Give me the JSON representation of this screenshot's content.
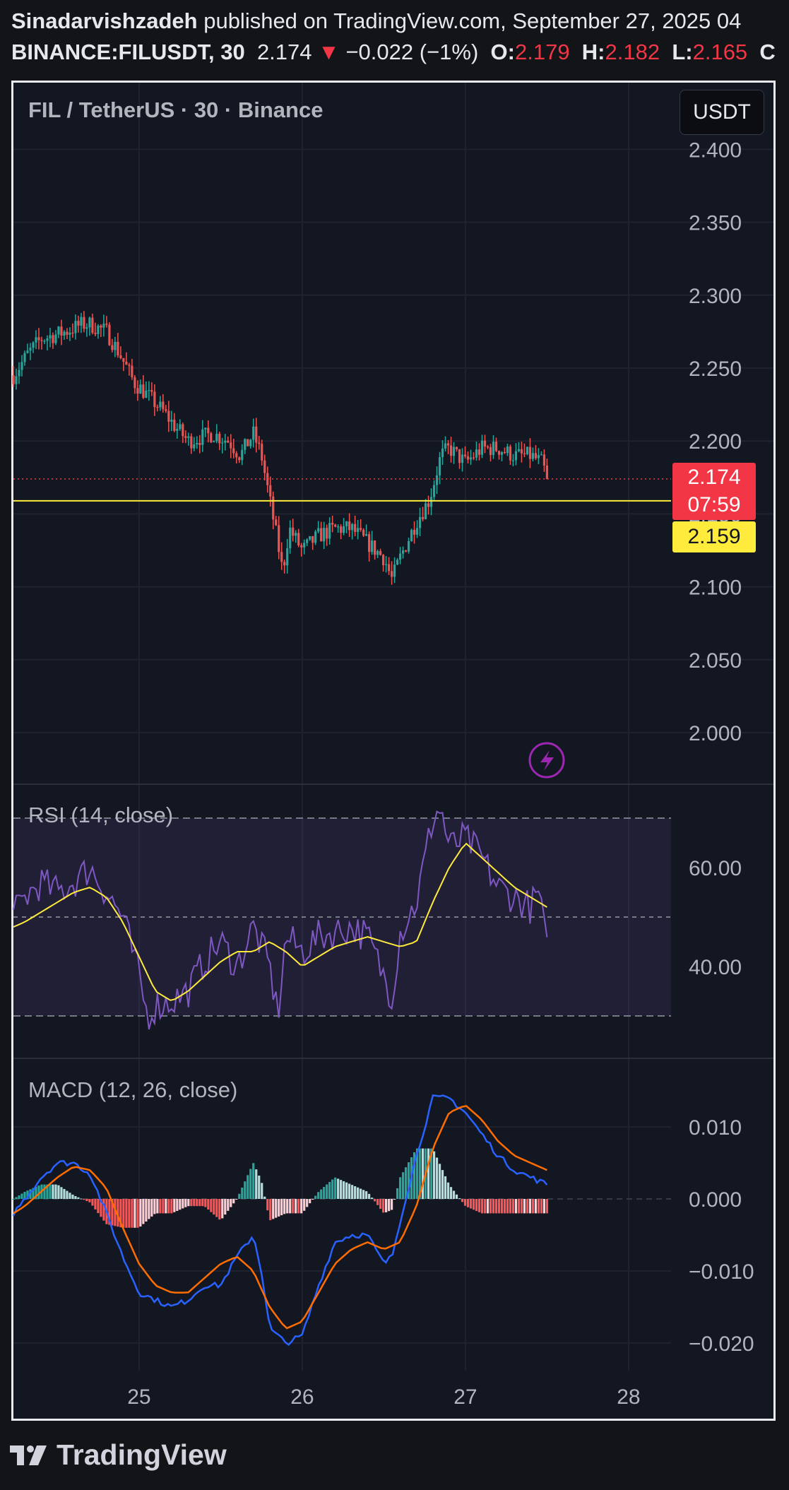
{
  "header": {
    "author": "Sinadarvishzadeh",
    "published_text": " published on TradingView.com, September 27, 2025 04",
    "symbol": "BINANCE:FILUSDT, 30",
    "last": "2.174",
    "change_arrow": "▼",
    "change": "−0.022 (−1%)",
    "o_label": "O:",
    "o_value": "2.179",
    "h_label": "H:",
    "h_value": "2.182",
    "l_label": "L:",
    "l_value": "2.165",
    "c_label": "C"
  },
  "chart_title": "FIL / TetherUS · 30 · Binance",
  "unit_button": "USDT",
  "current_price": "2.174",
  "countdown": "07:59",
  "level_price": "2.159",
  "rsi_label": "RSI (14, close)",
  "macd_label": "MACD (12, 26, close)",
  "footer_logo_text": "TradingView",
  "colors": {
    "up": "#26a69a",
    "down": "#ef5350",
    "rsi": "#7e57c2",
    "rsi_ma": "#ffeb3b",
    "macd": "#2962ff",
    "signal": "#ff6d00",
    "level": "#ffeb3b",
    "price_tag": "#f23645"
  },
  "chart_data": [
    {
      "type": "candlestick",
      "title": "FIL / TetherUS · 30 · Binance",
      "y_ticks": [
        "2.400",
        "2.350",
        "2.300",
        "2.250",
        "2.200",
        "2.150",
        "2.100",
        "2.050",
        "2.000"
      ],
      "ylim": [
        1.97,
        2.405
      ],
      "x_ticks": [
        "25",
        "26",
        "27",
        "28"
      ],
      "x_tick_values": [
        25,
        26,
        27,
        28
      ],
      "xlim": [
        24.23,
        28.26
      ],
      "horizontal_level": 2.159,
      "last_price": 2.174,
      "closes": {
        "x": [
          24.23,
          24.32,
          24.4,
          24.55,
          24.65,
          24.7,
          24.8,
          24.88,
          24.97,
          25.02,
          25.15,
          25.22,
          25.3,
          25.45,
          25.55,
          25.62,
          25.7,
          25.75,
          25.8,
          25.85,
          25.88,
          25.92,
          26.0,
          26.1,
          26.2,
          26.3,
          26.4,
          26.5,
          26.55,
          26.6,
          26.7,
          26.78,
          26.85,
          26.9,
          27.0,
          27.1,
          27.2,
          27.3,
          27.4,
          27.47,
          27.5
        ],
        "y": [
          2.245,
          2.26,
          2.27,
          2.275,
          2.28,
          2.28,
          2.275,
          2.26,
          2.24,
          2.235,
          2.22,
          2.21,
          2.2,
          2.205,
          2.2,
          2.19,
          2.205,
          2.19,
          2.16,
          2.13,
          2.11,
          2.14,
          2.125,
          2.135,
          2.14,
          2.14,
          2.13,
          2.12,
          2.105,
          2.12,
          2.145,
          2.16,
          2.19,
          2.195,
          2.185,
          2.195,
          2.195,
          2.19,
          2.19,
          2.185,
          2.174
        ]
      },
      "series": [
        {
          "name": "FIL / TetherUS",
          "type": "candles"
        }
      ]
    },
    {
      "type": "line",
      "title": "RSI (14, close)",
      "y_ticks": [
        "60.00",
        "40.00"
      ],
      "ylim": [
        24,
        76
      ],
      "bands": [
        30,
        50,
        70
      ],
      "series": [
        {
          "name": "RSI",
          "x": [
            24.23,
            24.3,
            24.4,
            24.5,
            24.6,
            24.7,
            24.8,
            24.9,
            25.0,
            25.05,
            25.1,
            25.2,
            25.3,
            25.4,
            25.5,
            25.6,
            25.7,
            25.8,
            25.85,
            25.9,
            26.0,
            26.1,
            26.2,
            26.3,
            26.4,
            26.5,
            26.55,
            26.6,
            26.7,
            26.8,
            26.85,
            26.9,
            27.0,
            27.1,
            27.2,
            27.3,
            27.4,
            27.45,
            27.5
          ],
          "y": [
            50,
            54,
            57,
            55,
            57,
            60,
            55,
            50,
            38,
            30,
            32,
            33,
            35,
            41,
            45,
            40,
            48,
            40,
            30,
            46,
            43,
            46,
            47,
            48,
            46,
            38,
            34,
            47,
            53,
            70,
            72,
            64,
            66,
            62,
            56,
            54,
            52,
            55,
            43
          ]
        },
        {
          "name": "RSI-based MA",
          "x": [
            24.23,
            24.3,
            24.4,
            24.5,
            24.6,
            24.7,
            24.8,
            24.9,
            25.0,
            25.1,
            25.2,
            25.3,
            25.4,
            25.5,
            25.6,
            25.7,
            25.8,
            25.9,
            26.0,
            26.1,
            26.2,
            26.3,
            26.4,
            26.5,
            26.6,
            26.7,
            26.8,
            26.9,
            27.0,
            27.1,
            27.2,
            27.3,
            27.4,
            27.5
          ],
          "y": [
            48,
            49,
            51,
            53,
            55,
            56,
            54,
            49,
            42,
            35,
            33,
            35,
            38,
            41,
            43,
            43,
            45,
            43,
            40,
            42,
            44,
            45,
            46,
            45,
            44,
            45,
            53,
            60,
            65,
            62,
            59,
            56,
            54,
            52
          ]
        }
      ]
    },
    {
      "type": "line",
      "title": "MACD (12, 26, close)",
      "y_ticks": [
        "0.010",
        "0.000",
        "−0.010",
        "−0.020"
      ],
      "ylim": [
        -0.0205,
        0.016
      ],
      "series": [
        {
          "name": "MACD",
          "x": [
            24.23,
            24.3,
            24.4,
            24.5,
            24.6,
            24.7,
            24.8,
            24.9,
            25.0,
            25.1,
            25.2,
            25.3,
            25.4,
            25.5,
            25.6,
            25.7,
            25.75,
            25.8,
            25.9,
            26.0,
            26.1,
            26.2,
            26.3,
            26.4,
            26.5,
            26.55,
            26.6,
            26.7,
            26.8,
            26.9,
            27.0,
            27.1,
            27.2,
            27.3,
            27.4,
            27.5
          ],
          "y": [
            -0.002,
            0.0,
            0.003,
            0.005,
            0.005,
            0.0035,
            -0.002,
            -0.008,
            -0.013,
            -0.014,
            -0.015,
            -0.014,
            -0.012,
            -0.012,
            -0.008,
            -0.005,
            -0.01,
            -0.018,
            -0.02,
            -0.019,
            -0.012,
            -0.006,
            -0.005,
            -0.005,
            -0.009,
            -0.008,
            -0.003,
            0.006,
            0.014,
            0.014,
            0.012,
            0.009,
            0.006,
            0.004,
            0.003,
            0.002
          ]
        },
        {
          "name": "Signal",
          "x": [
            24.23,
            24.3,
            24.4,
            24.5,
            24.6,
            24.7,
            24.8,
            24.9,
            25.0,
            25.1,
            25.2,
            25.3,
            25.4,
            25.5,
            25.6,
            25.7,
            25.8,
            25.9,
            26.0,
            26.1,
            26.2,
            26.3,
            26.4,
            26.5,
            26.6,
            26.7,
            26.8,
            26.9,
            27.0,
            27.1,
            27.2,
            27.3,
            27.4,
            27.5
          ],
          "y": [
            -0.002,
            -0.001,
            0.001,
            0.003,
            0.0045,
            0.004,
            0.0015,
            -0.004,
            -0.009,
            -0.012,
            -0.013,
            -0.013,
            -0.011,
            -0.009,
            -0.008,
            -0.01,
            -0.015,
            -0.018,
            -0.017,
            -0.013,
            -0.009,
            -0.007,
            -0.006,
            -0.007,
            -0.006,
            -0.001,
            0.007,
            0.012,
            0.013,
            0.011,
            0.008,
            0.006,
            0.005,
            0.004
          ]
        }
      ]
    }
  ]
}
